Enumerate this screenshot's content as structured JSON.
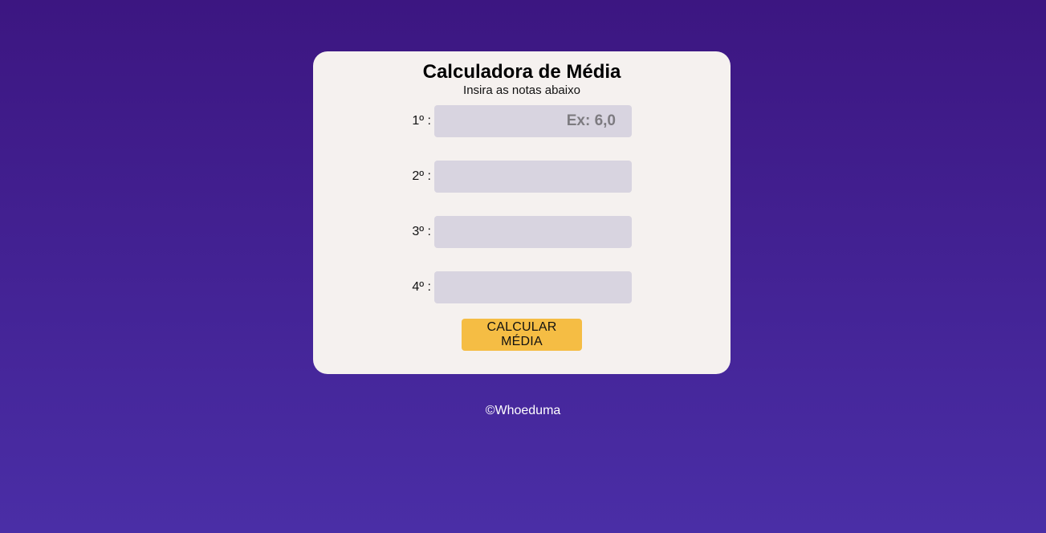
{
  "card": {
    "title": "Calculadora de Média",
    "subtitle": "Insira as notas abaixo"
  },
  "grades": [
    {
      "label": "1º :",
      "value": "",
      "placeholder": "Ex: 6,0"
    },
    {
      "label": "2º :",
      "value": "",
      "placeholder": ""
    },
    {
      "label": "3º :",
      "value": "",
      "placeholder": ""
    },
    {
      "label": "4º :",
      "value": "",
      "placeholder": ""
    }
  ],
  "button": {
    "label": "CALCULAR MÉDIA"
  },
  "footer": {
    "text": "©Whoeduma"
  },
  "colors": {
    "background_top": "#3c1681",
    "background_bottom": "#4a2ea6",
    "card": "#f5f1ef",
    "input": "#d8d4e0",
    "button": "#f5bd44"
  }
}
